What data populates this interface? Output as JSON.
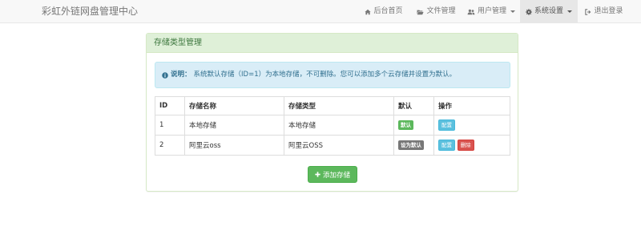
{
  "navbar": {
    "brand": "彩虹外链网盘管理中心",
    "items": [
      {
        "label": "后台首页",
        "icon": "home-icon"
      },
      {
        "label": "文件管理",
        "icon": "folder-open-icon"
      },
      {
        "label": "用户管理",
        "icon": "users-icon",
        "dropdown": true
      },
      {
        "label": "系统设置",
        "icon": "gear-icon",
        "dropdown": true,
        "active": true
      },
      {
        "label": "退出登录",
        "icon": "sign-out-icon"
      }
    ]
  },
  "panel": {
    "title": "存储类型管理",
    "alert_label": "说明：",
    "alert_text": "系统默认存储（ID=1）为本地存储，不可删除。您可以添加多个云存储并设置为默认。",
    "table": {
      "headers": [
        "ID",
        "存储名称",
        "存储类型",
        "默认",
        "操作"
      ],
      "rows": [
        {
          "id": "1",
          "name": "本地存储",
          "type": "本地存储",
          "default": "默认",
          "actions": [
            "配置"
          ]
        },
        {
          "id": "2",
          "name": "阿里云oss",
          "type": "阿里云OSS",
          "default": "设为默认",
          "actions": [
            "配置",
            "删除"
          ]
        }
      ]
    },
    "add_button": "添加存储"
  }
}
